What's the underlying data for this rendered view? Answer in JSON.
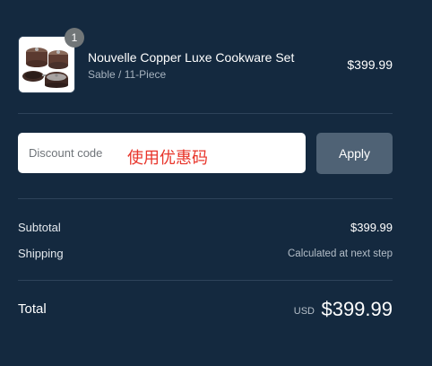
{
  "line_item": {
    "quantity": "1",
    "title": "Nouvelle Copper Luxe Cookware Set",
    "variant": "Sable / 11-Piece",
    "price": "$399.99",
    "image_icon": "cookware-set-thumbnail"
  },
  "discount": {
    "placeholder": "Discount code",
    "annotation": "使用优惠码",
    "apply_label": "Apply"
  },
  "totals": {
    "subtotal_label": "Subtotal",
    "subtotal_value": "$399.99",
    "shipping_label": "Shipping",
    "shipping_value": "Calculated at next step",
    "total_label": "Total",
    "total_currency": "USD",
    "total_value": "$399.99"
  },
  "colors": {
    "background": "#14293f",
    "apply_button": "#4f6275",
    "annotation_red": "#e8342a",
    "badge": "#717678"
  }
}
